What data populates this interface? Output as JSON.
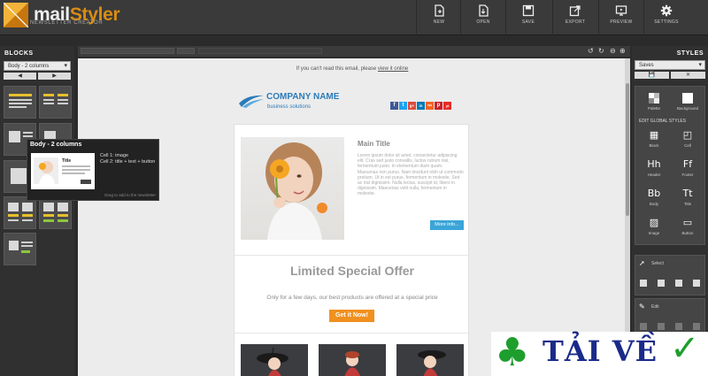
{
  "app": {
    "logo_main": "mail",
    "logo_accent": "Styler",
    "logo_sub": "NEWSLETTER CREATOR"
  },
  "toolbar": [
    {
      "label": "NEW",
      "icon": "new-file-icon"
    },
    {
      "label": "OPEN",
      "icon": "open-file-icon"
    },
    {
      "label": "SAVE",
      "icon": "save-icon"
    },
    {
      "label": "EXPORT",
      "icon": "export-icon"
    },
    {
      "label": "PREVIEW",
      "icon": "preview-icon"
    },
    {
      "label": "SETTINGS",
      "icon": "gear-icon"
    }
  ],
  "blocks_panel": {
    "title": "BLOCKS",
    "select_value": "Body - 2 columns",
    "prev": "◀",
    "next": "▶"
  },
  "tooltip": {
    "title": "Body - 2 columns",
    "cell1": "Cell 1: image",
    "cell2": "Cell 2: title + text + button",
    "card_title": "Title",
    "hint": "Drag to add to the newsletter"
  },
  "email": {
    "preheader": "If you can't read this email, please",
    "preheader_link": "view it online",
    "company_name": "COMPANY NAME",
    "company_sub": "business solutions",
    "social": [
      "f",
      "t",
      "g+",
      "in",
      "rss",
      "p",
      "yt"
    ],
    "main_title": "Main Title",
    "main_text": "Lorem ipsum dolor sit amet, consectetur adipiscing elit. Cras sed justo convallis, luctus rutrum nisi, fermentum justo. In elementum diam quam. Maecenas non purus. Nam tincidunt nibh ut commodo pretium. Ut in est purus, fermentum in molestie. Sed ac nisl dignissim. Nulla lectus, suscipit id, libero in dignissim. Maecenas velit nulla, fermentum in molestie.",
    "more_button": "More info...",
    "offer_title": "Limited Special Offer",
    "offer_text": "Only for a few days, our best products are offered at a special price",
    "offer_button": "Get it Now!"
  },
  "styles_panel": {
    "title": "STYLES",
    "select_value": "Saves",
    "btn_save": "💾",
    "btn_close": "✕",
    "palette_label": "Palette",
    "background_label": "Background",
    "edit_global": "EDIT GLOBAL STYLES",
    "tiles": [
      {
        "label": "Block",
        "icon": "▦"
      },
      {
        "label": "Cell",
        "icon": "◰"
      },
      {
        "label": "Header",
        "icon": "Hh"
      },
      {
        "label": "Footer",
        "icon": "Ff"
      },
      {
        "label": "Body",
        "icon": "Bb"
      },
      {
        "label": "Title",
        "icon": "Tt"
      },
      {
        "label": "Image",
        "icon": "▨"
      },
      {
        "label": "Button",
        "icon": "▭"
      }
    ],
    "select_label": "Select",
    "edit_label": "Edit"
  },
  "watermark": {
    "text": "TẢI VỀ",
    "check": "✓",
    "clover": "♣"
  },
  "colors": {
    "accent": "#d88c16",
    "link_blue": "#2b7bb9",
    "button_blue": "#3aa5d8",
    "button_orange": "#f0901e"
  }
}
